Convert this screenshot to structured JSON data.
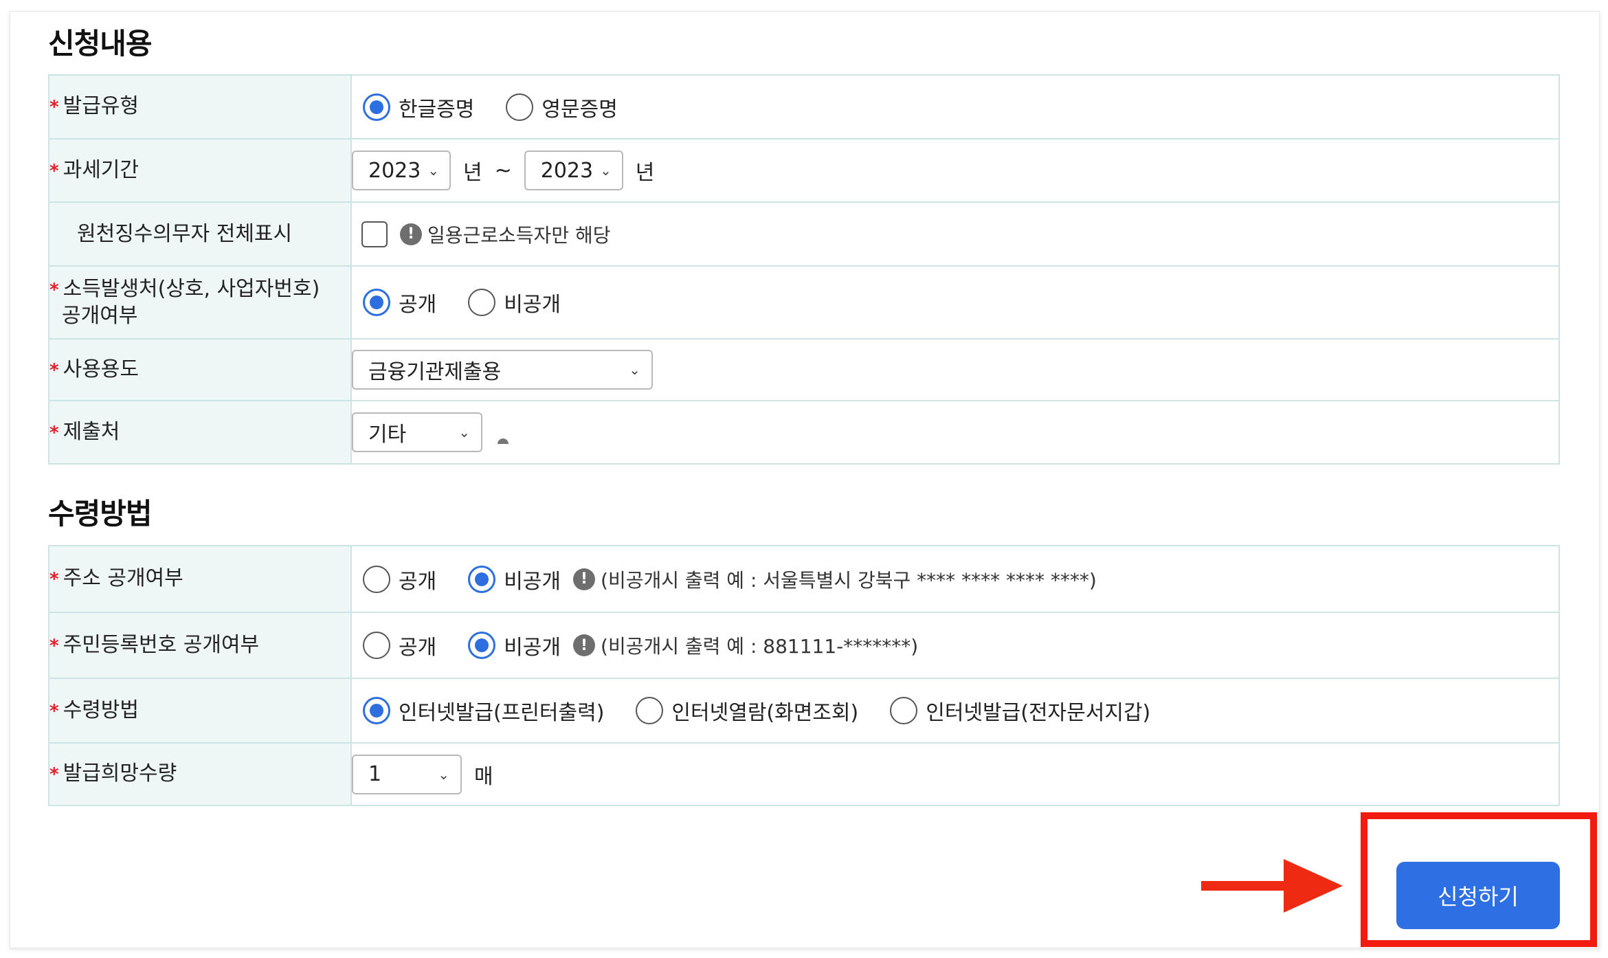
{
  "sections": {
    "apply": "신청내용",
    "receive": "수령방법"
  },
  "required_mark": "*",
  "issue_type": {
    "label": "발급유형",
    "options": [
      "한글증명",
      "영문증명"
    ],
    "selected": "한글증명"
  },
  "tax_period": {
    "label": "과세기간",
    "from": "2023",
    "to": "2023",
    "unit": "년",
    "sep": "~"
  },
  "withholding": {
    "label": "원천징수의무자 전체표시",
    "checked": false,
    "note": "일용근로소득자만 해당"
  },
  "income_source": {
    "label_line1": "소득발생처(상호, 사업자번호)",
    "label_line2": "공개여부",
    "options": [
      "공개",
      "비공개"
    ],
    "selected": "공개"
  },
  "usage": {
    "label": "사용용도",
    "value": "금융기관제출용"
  },
  "submit_to": {
    "label": "제출처",
    "value": "기타"
  },
  "address_public": {
    "label": "주소 공개여부",
    "options": [
      "공개",
      "비공개"
    ],
    "selected": "비공개",
    "note": "(비공개시 출력 예 : 서울특별시 강북구 **** **** **** ****)"
  },
  "rrn_public": {
    "label": "주민등록번호 공개여부",
    "options": [
      "공개",
      "비공개"
    ],
    "selected": "비공개",
    "note": "(비공개시 출력 예 : 881111-*******)"
  },
  "receive_method": {
    "label": "수령방법",
    "options": [
      "인터넷발급(프린터출력)",
      "인터넷열람(화면조회)",
      "인터넷발급(전자문서지갑)"
    ],
    "selected": "인터넷발급(프린터출력)"
  },
  "quantity": {
    "label": "발급희망수량",
    "value": "1",
    "unit": "매"
  },
  "submit_button": "신청하기",
  "icons": {
    "chevron": "chevron-down-icon",
    "info": "info-icon",
    "arrow": "arrow-right-icon"
  },
  "colors": {
    "accent": "#2f6fe4",
    "required": "#e2202f",
    "highlight": "#f21b0f",
    "label_bg": "#eef6f6"
  }
}
